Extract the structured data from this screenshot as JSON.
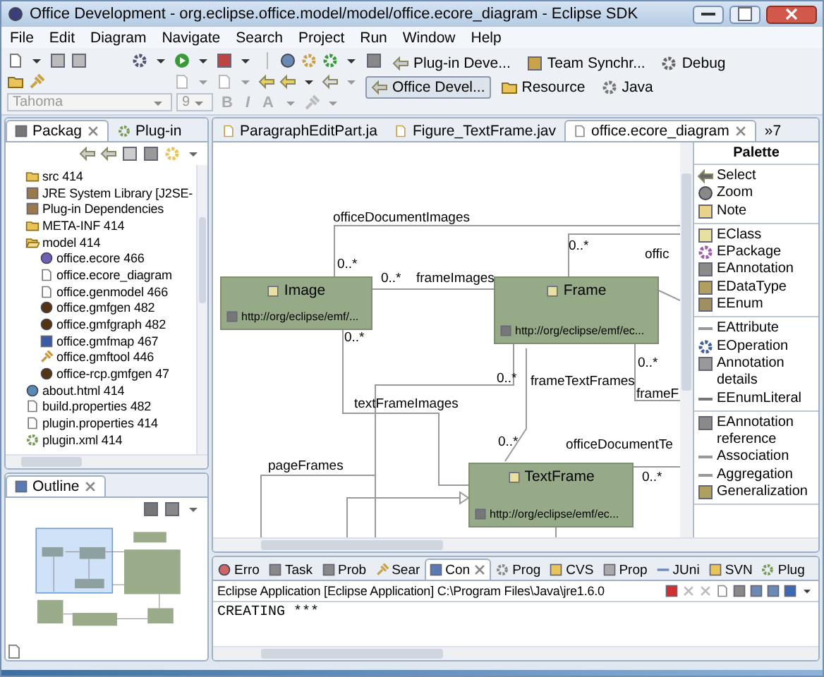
{
  "window": {
    "title": "Office Development - org.eclipse.office.model/model/office.ecore_diagram - Eclipse SDK"
  },
  "menu": [
    "File",
    "Edit",
    "Diagram",
    "Navigate",
    "Search",
    "Project",
    "Run",
    "Window",
    "Help"
  ],
  "toolbar": {
    "font_field": {
      "value": "Tahoma"
    },
    "size_field": {
      "value": "9"
    },
    "format_buttons": [
      {
        "label": "B",
        "disabled": true
      },
      {
        "label": "I",
        "disabled": true
      },
      {
        "label": "A",
        "disabled": true
      }
    ],
    "perspectives": [
      {
        "label": "Plug-in Deve...",
        "selected": false
      },
      {
        "label": "Team Synchr...",
        "selected": false
      },
      {
        "label": "Debug",
        "selected": false
      },
      {
        "label": "Office Devel...",
        "selected": true
      },
      {
        "label": "Resource",
        "selected": false
      },
      {
        "label": "Java",
        "selected": false
      }
    ]
  },
  "package_view": {
    "tabs": [
      {
        "label": "Packag",
        "selected": true
      },
      {
        "label": "Plug-in",
        "selected": false
      }
    ],
    "tree": [
      {
        "label": "src 414",
        "kind": "folder"
      },
      {
        "label": "JRE System Library [J2SE-",
        "kind": "library"
      },
      {
        "label": "Plug-in Dependencies",
        "kind": "library"
      },
      {
        "label": "META-INF 414",
        "kind": "folder"
      },
      {
        "label": "model 414",
        "kind": "folder",
        "expanded": true,
        "children": [
          {
            "label": "office.ecore 466",
            "kind": "model"
          },
          {
            "label": "office.ecore_diagram",
            "kind": "file"
          },
          {
            "label": "office.genmodel 466",
            "kind": "file"
          },
          {
            "label": "office.gmfgen 482",
            "kind": "gmf"
          },
          {
            "label": "office.gmfgraph 482",
            "kind": "gmf"
          },
          {
            "label": "office.gmfmap 467",
            "kind": "map"
          },
          {
            "label": "office.gmftool 446",
            "kind": "tool"
          },
          {
            "label": "office-rcp.gmfgen 47",
            "kind": "gmf"
          }
        ]
      },
      {
        "label": "about.html 414",
        "kind": "web"
      },
      {
        "label": "build.properties 482",
        "kind": "file"
      },
      {
        "label": "plugin.properties 414",
        "kind": "file"
      },
      {
        "label": "plugin.xml 414",
        "kind": "plugin"
      }
    ]
  },
  "outline": {
    "tabs": [
      {
        "label": "Outline",
        "selected": true
      }
    ]
  },
  "editor": {
    "tabs": [
      {
        "label": "ParagraphEditPart.ja",
        "selected": false
      },
      {
        "label": "Figure_TextFrame.jav",
        "selected": false
      },
      {
        "label": "office.ecore_diagram",
        "selected": true
      }
    ],
    "overflow": "»7"
  },
  "diagram": {
    "nodes": [
      {
        "name": "Image",
        "uri": "http://org/eclipse/emf/..."
      },
      {
        "name": "Frame",
        "uri": "http://org/eclipse/emf/ec..."
      },
      {
        "name": "TextFrame",
        "uri": "http://org/eclipse/emf/ec..."
      }
    ],
    "labels": [
      "officeDocumentImages",
      "0..*",
      "offic",
      "0..*",
      "0..*",
      "frameImages",
      "0..*",
      "0..*",
      "0..*",
      "frameTextFrames",
      "frameF",
      "textFrameImages",
      "0..*",
      "officeDocumentTe",
      "pageFrames",
      "0..*"
    ]
  },
  "palette": {
    "title": "Palette",
    "groups": [
      [
        "Select",
        "Zoom",
        "Note"
      ],
      [
        "EClass",
        "EPackage",
        "EAnnotation",
        "EDataType",
        "EEnum"
      ],
      [
        "EAttribute",
        "EOperation",
        "Annotation details",
        "EEnumLiteral"
      ],
      [
        "EAnnotation reference",
        "Association",
        "Aggregation",
        "Generalization"
      ]
    ]
  },
  "console": {
    "tabs": [
      {
        "label": "Erro",
        "selected": false
      },
      {
        "label": "Task",
        "selected": false
      },
      {
        "label": "Prob",
        "selected": false
      },
      {
        "label": "Sear",
        "selected": false
      },
      {
        "label": "Con",
        "selected": true
      },
      {
        "label": "Prog",
        "selected": false
      },
      {
        "label": "CVS",
        "selected": false
      },
      {
        "label": "Prop",
        "selected": false
      },
      {
        "label": "JUni",
        "selected": false
      },
      {
        "label": "SVN",
        "selected": false
      },
      {
        "label": "Plug",
        "selected": false
      }
    ],
    "header": "Eclipse Application [Eclipse Application] C:\\Program Files\\Java\\jre1.6.0",
    "output": "CREATING ***"
  }
}
